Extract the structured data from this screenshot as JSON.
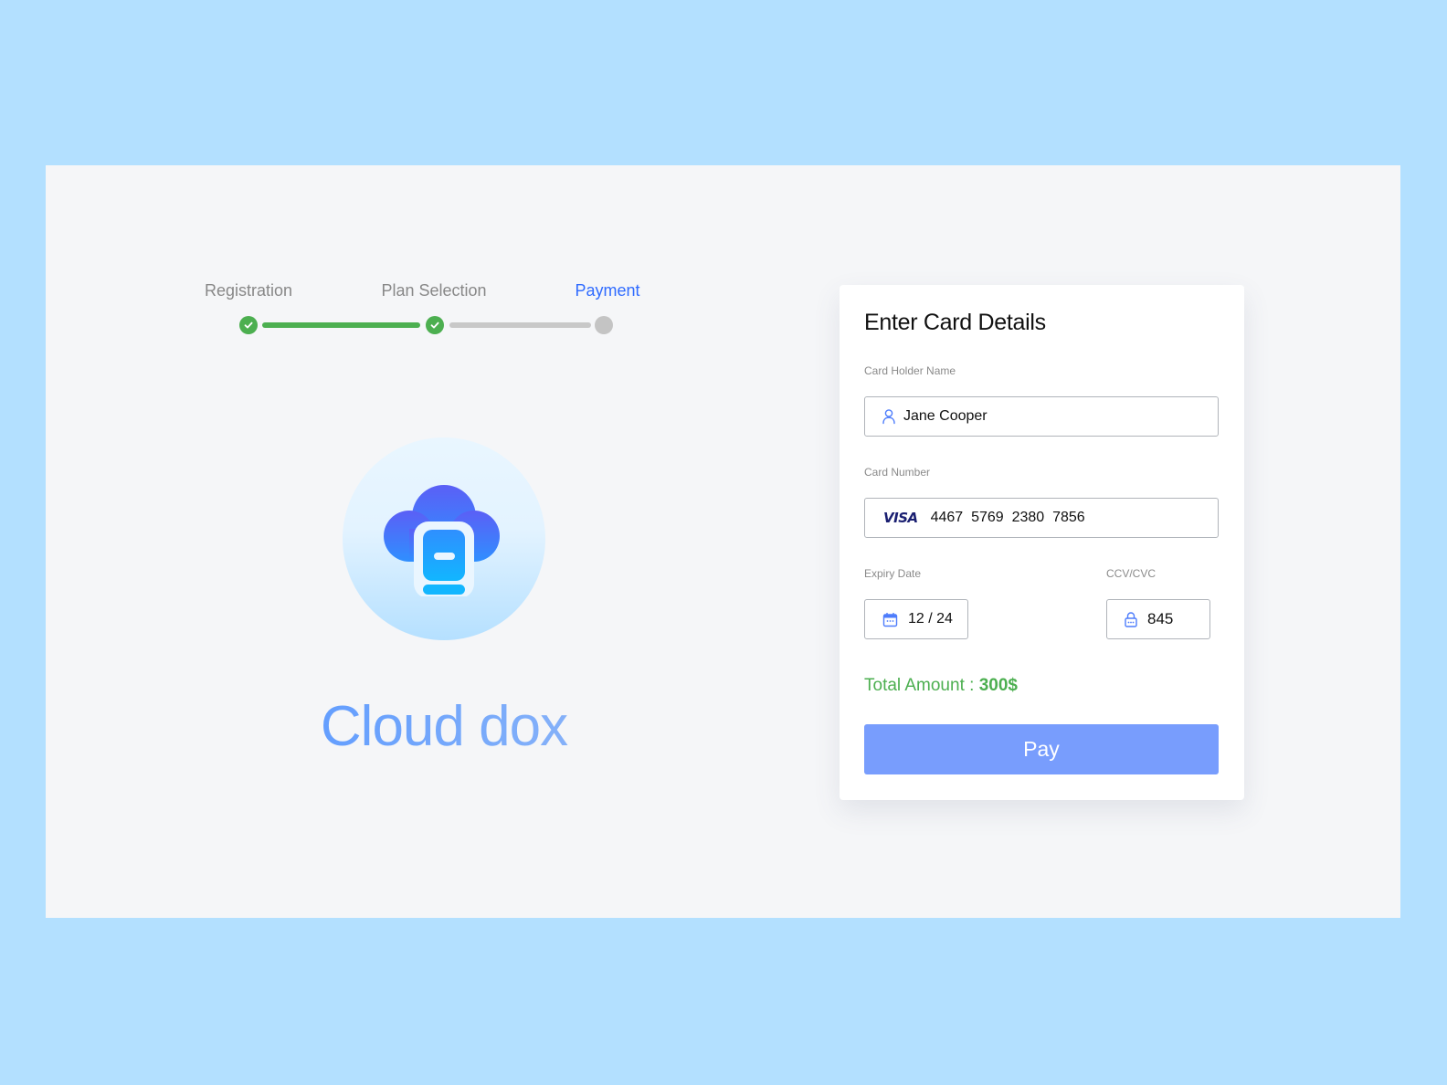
{
  "stepper": {
    "steps": [
      {
        "label": "Registration",
        "status": "complete"
      },
      {
        "label": "Plan Selection",
        "status": "complete"
      },
      {
        "label": "Payment",
        "status": "current"
      }
    ],
    "colors": {
      "complete": "#4caf50",
      "pending": "#c4c4c4",
      "current": "#2f6bff"
    }
  },
  "brand": {
    "name": "Cloud dox",
    "logo_icon": "cloud-book-icon"
  },
  "card": {
    "title": "Enter Card Details",
    "holder": {
      "label": "Card Holder Name",
      "value": "Jane Cooper",
      "icon": "user-icon"
    },
    "number": {
      "label": "Card Number",
      "brand": "VISA",
      "value": "4467  5769  2380  7856",
      "icon": "visa-logo"
    },
    "expiry": {
      "label": "Expiry Date",
      "value": "12 / 24",
      "icon": "calendar-icon"
    },
    "cvc": {
      "label": "CCV/CVC",
      "value": "845",
      "icon": "lock-icon"
    },
    "total": {
      "label": "Total Amount : ",
      "amount": "300$"
    },
    "pay_label": "Pay"
  },
  "colors": {
    "page_background": "#b3e0ff",
    "panel_background": "#f5f6f8",
    "accent_blue": "#2f6bff",
    "pay_button": "#789dfd",
    "success_green": "#4caf50"
  }
}
